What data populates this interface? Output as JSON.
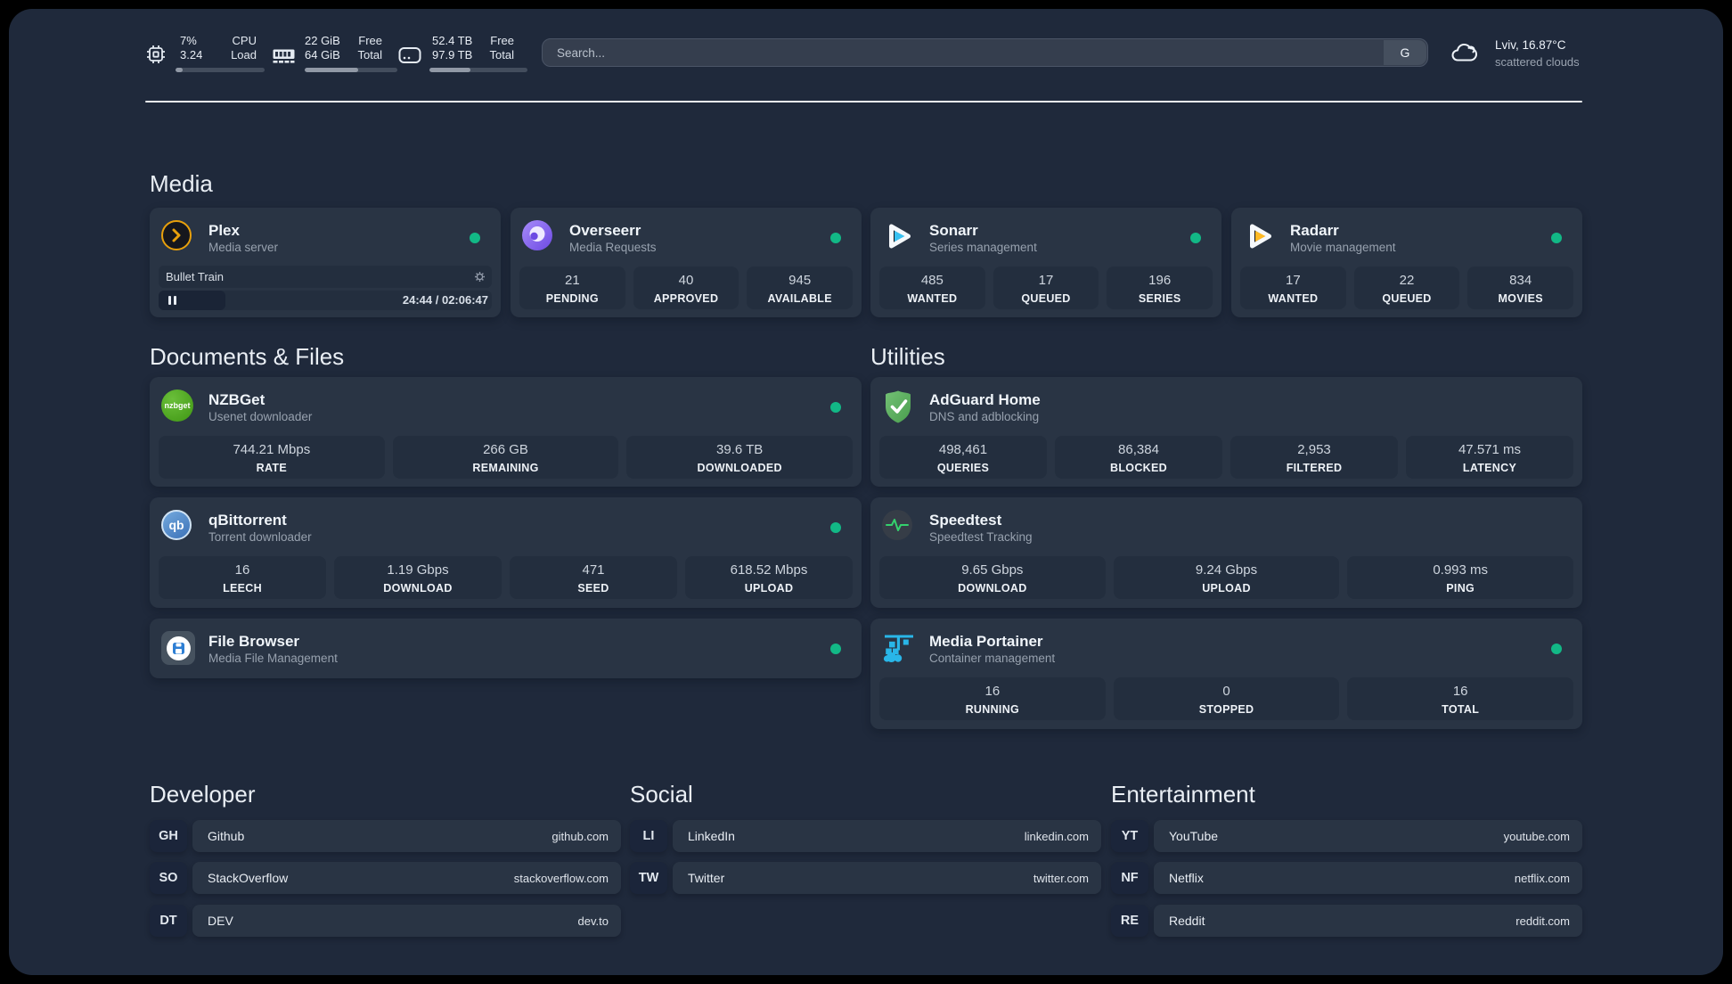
{
  "header": {
    "cpu": {
      "value_line1": "7%",
      "value_line2": "3.24",
      "label_line1": "CPU",
      "label_line2": "Load",
      "usage_pct": 8
    },
    "memory": {
      "value_line1": "22 GiB",
      "value_line2": "64 GiB",
      "label_line1": "Free",
      "label_line2": "Total",
      "usage_pct": 58
    },
    "disk": {
      "value_line1": "52.4 TB",
      "value_line2": "97.9 TB",
      "label_line1": "Free",
      "label_line2": "Total",
      "usage_pct": 42
    },
    "search": {
      "placeholder": "Search...",
      "button_label": "G"
    },
    "weather": {
      "location_temp": "Lviv, 16.87°C",
      "condition": "scattered clouds"
    }
  },
  "sections": {
    "media": {
      "heading": "Media"
    },
    "documents": {
      "heading": "Documents & Files"
    },
    "utilities": {
      "heading": "Utilities"
    },
    "developer": {
      "heading": "Developer"
    },
    "social": {
      "heading": "Social"
    },
    "entertainment": {
      "heading": "Entertainment"
    }
  },
  "services": {
    "plex": {
      "title": "Plex",
      "subtitle": "Media server",
      "status": "online",
      "now_playing": {
        "title": "Bullet Train",
        "time_display": "24:44 / 02:06:47",
        "state": "paused"
      }
    },
    "overseerr": {
      "title": "Overseerr",
      "subtitle": "Media Requests",
      "status": "online",
      "stats": [
        {
          "value": "21",
          "label": "PENDING"
        },
        {
          "value": "40",
          "label": "APPROVED"
        },
        {
          "value": "945",
          "label": "AVAILABLE"
        }
      ]
    },
    "sonarr": {
      "title": "Sonarr",
      "subtitle": "Series management",
      "status": "online",
      "stats": [
        {
          "value": "485",
          "label": "WANTED"
        },
        {
          "value": "17",
          "label": "QUEUED"
        },
        {
          "value": "196",
          "label": "SERIES"
        }
      ]
    },
    "radarr": {
      "title": "Radarr",
      "subtitle": "Movie management",
      "status": "online",
      "stats": [
        {
          "value": "17",
          "label": "WANTED"
        },
        {
          "value": "22",
          "label": "QUEUED"
        },
        {
          "value": "834",
          "label": "MOVIES"
        }
      ]
    },
    "nzbget": {
      "title": "NZBGet",
      "subtitle": "Usenet downloader",
      "status": "online",
      "icon_text": "nzbget",
      "stats": [
        {
          "value": "744.21 Mbps",
          "label": "RATE"
        },
        {
          "value": "266 GB",
          "label": "REMAINING"
        },
        {
          "value": "39.6 TB",
          "label": "DOWNLOADED"
        }
      ]
    },
    "adguard": {
      "title": "AdGuard Home",
      "subtitle": "DNS and adblocking",
      "stats": [
        {
          "value": "498,461",
          "label": "QUERIES"
        },
        {
          "value": "86,384",
          "label": "BLOCKED"
        },
        {
          "value": "2,953",
          "label": "FILTERED"
        },
        {
          "value": "47.571 ms",
          "label": "LATENCY"
        }
      ]
    },
    "qbittorrent": {
      "title": "qBittorrent",
      "subtitle": "Torrent downloader",
      "status": "online",
      "icon_text": "qb",
      "stats": [
        {
          "value": "16",
          "label": "LEECH"
        },
        {
          "value": "1.19 Gbps",
          "label": "DOWNLOAD"
        },
        {
          "value": "471",
          "label": "SEED"
        },
        {
          "value": "618.52 Mbps",
          "label": "UPLOAD"
        }
      ]
    },
    "speedtest": {
      "title": "Speedtest",
      "subtitle": "Speedtest Tracking",
      "stats": [
        {
          "value": "9.65 Gbps",
          "label": "DOWNLOAD"
        },
        {
          "value": "9.24 Gbps",
          "label": "UPLOAD"
        },
        {
          "value": "0.993 ms",
          "label": "PING"
        }
      ]
    },
    "filebrowser": {
      "title": "File Browser",
      "subtitle": "Media File Management",
      "status": "online"
    },
    "portainer": {
      "title": "Media Portainer",
      "subtitle": "Container management",
      "status": "online",
      "stats": [
        {
          "value": "16",
          "label": "RUNNING"
        },
        {
          "value": "0",
          "label": "STOPPED"
        },
        {
          "value": "16",
          "label": "TOTAL"
        }
      ]
    }
  },
  "bookmarks": {
    "developer": [
      {
        "abbr": "GH",
        "name": "Github",
        "url": "github.com"
      },
      {
        "abbr": "SO",
        "name": "StackOverflow",
        "url": "stackoverflow.com"
      },
      {
        "abbr": "DT",
        "name": "DEV",
        "url": "dev.to"
      }
    ],
    "social": [
      {
        "abbr": "LI",
        "name": "LinkedIn",
        "url": "linkedin.com"
      },
      {
        "abbr": "TW",
        "name": "Twitter",
        "url": "twitter.com"
      }
    ],
    "entertainment": [
      {
        "abbr": "YT",
        "name": "YouTube",
        "url": "youtube.com"
      },
      {
        "abbr": "NF",
        "name": "Netflix",
        "url": "netflix.com"
      },
      {
        "abbr": "RE",
        "name": "Reddit",
        "url": "reddit.com"
      }
    ]
  },
  "colors": {
    "status_online": "#12b886",
    "page_bg": "#1f293b",
    "card_bg": "#293444"
  }
}
